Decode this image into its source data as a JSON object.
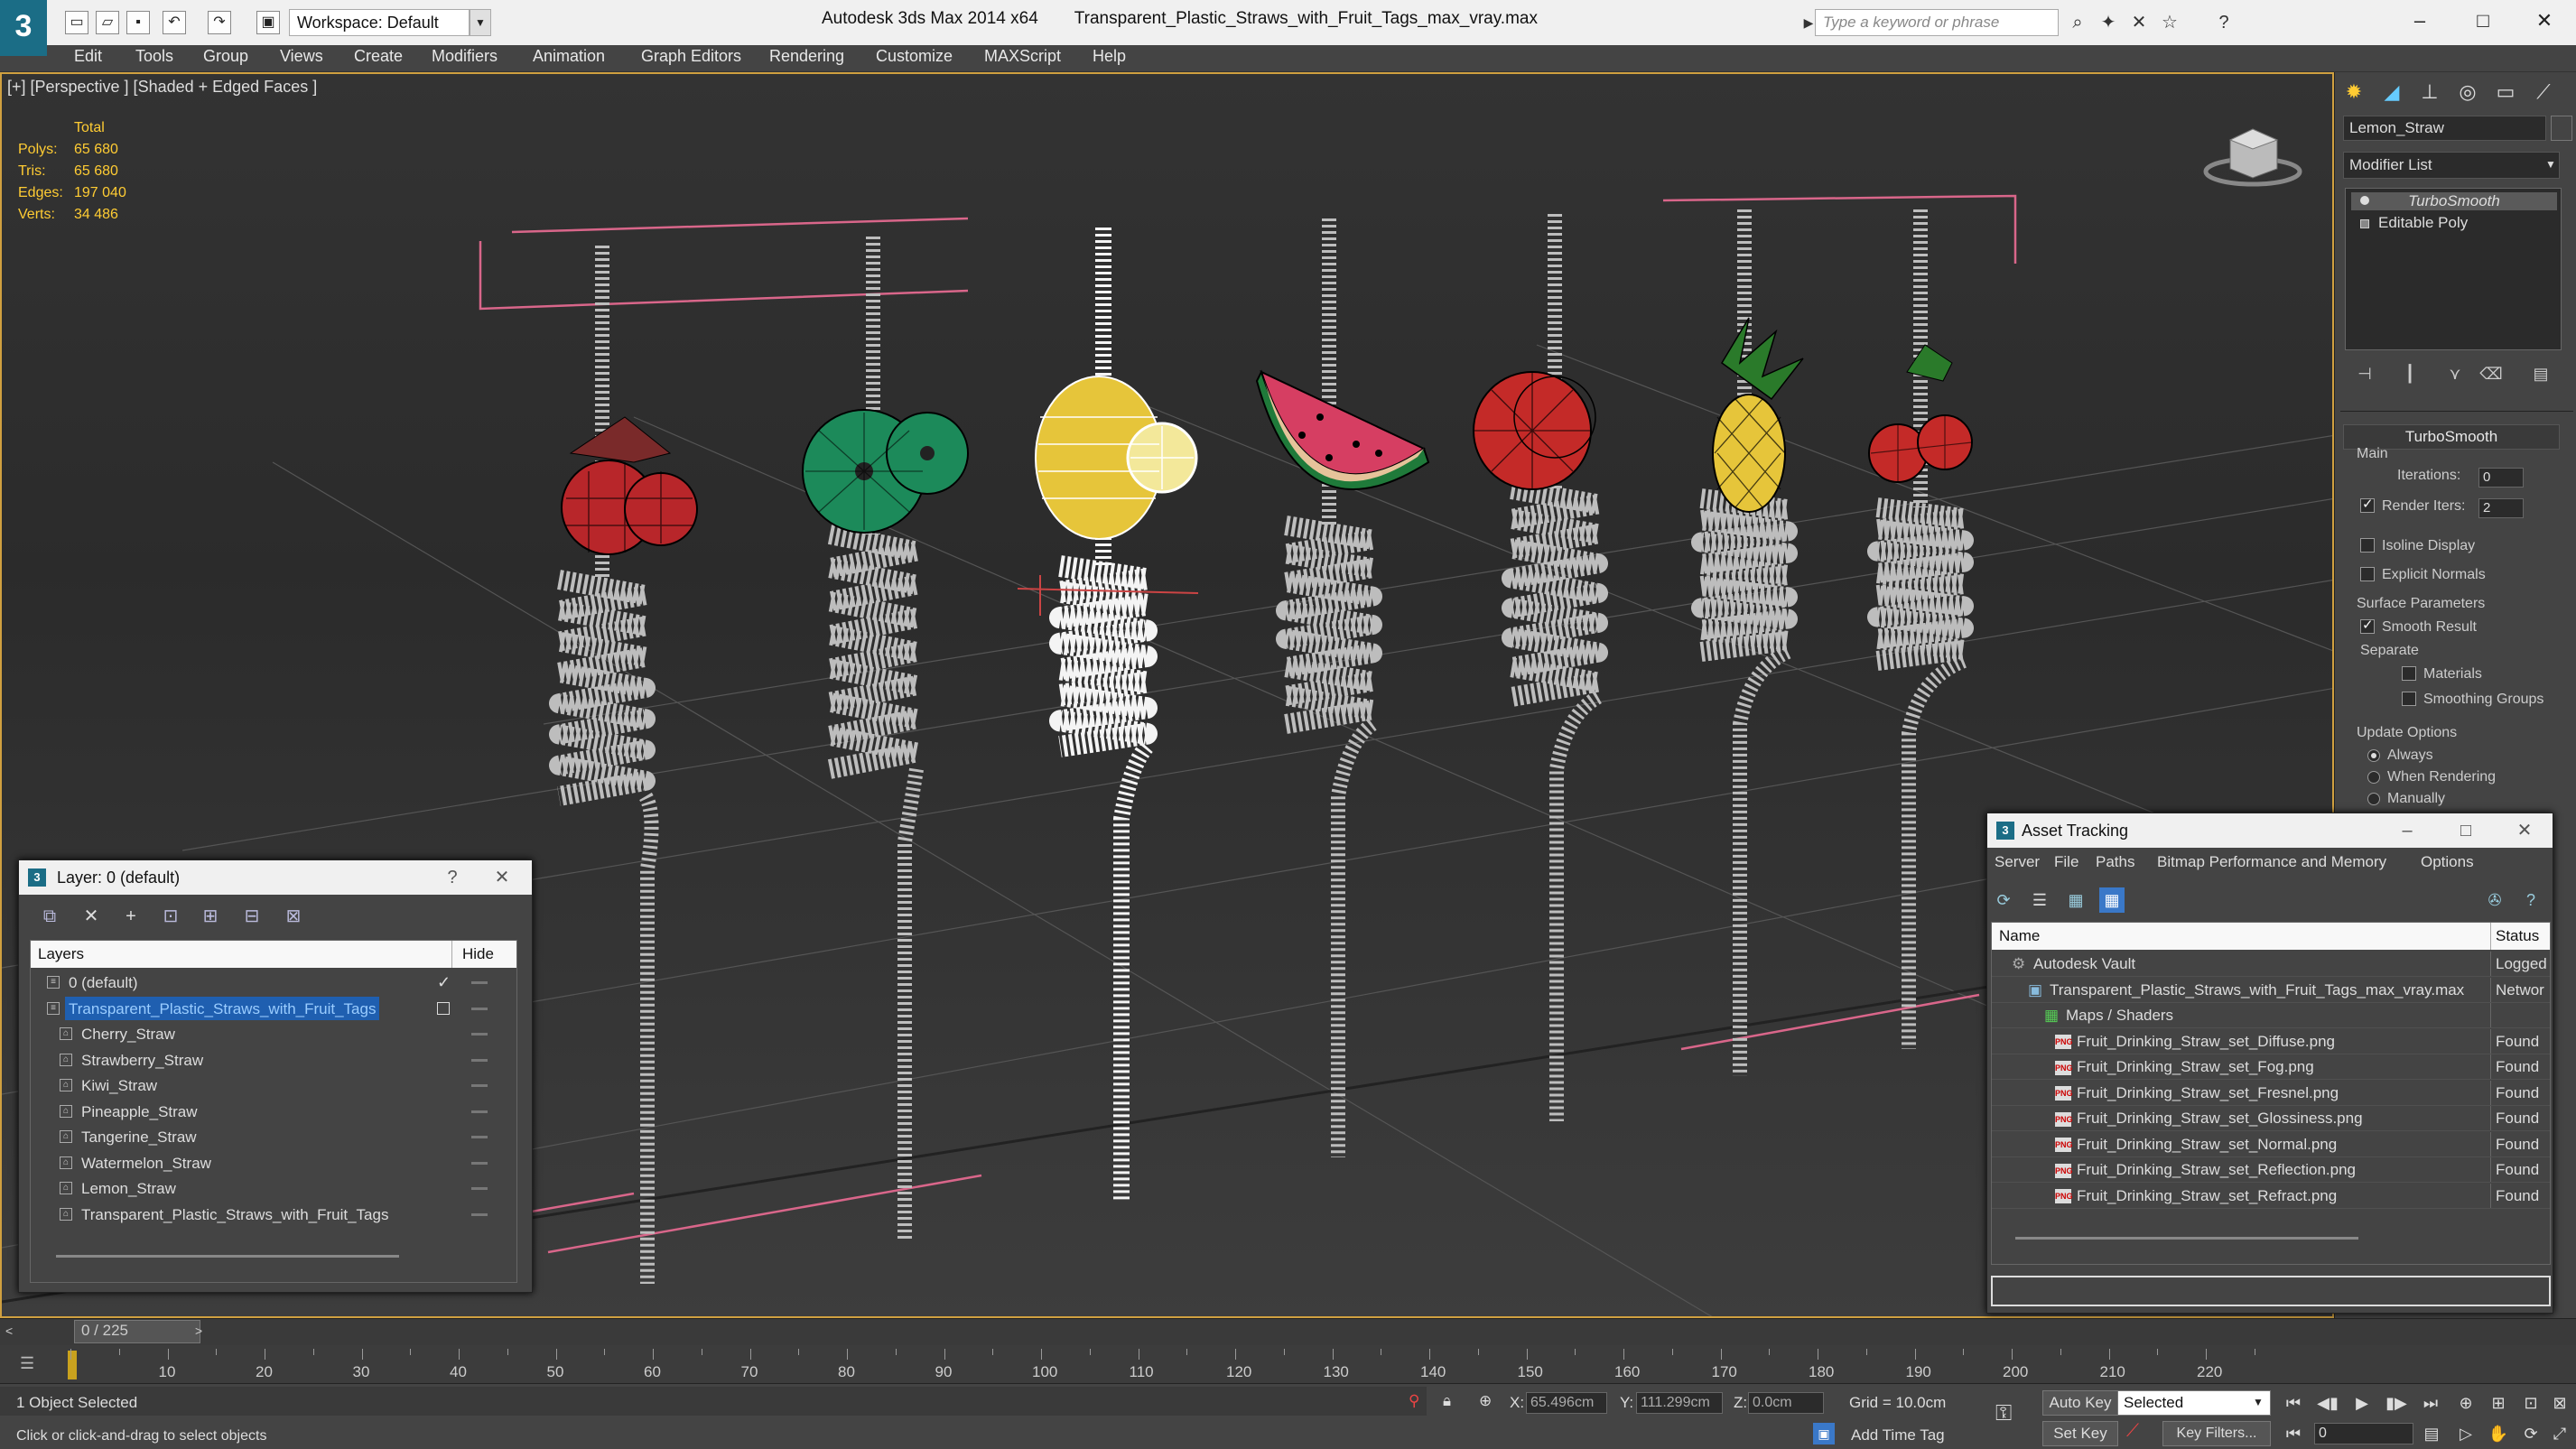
{
  "titlebar": {
    "app_name": "Autodesk 3ds Max  2014 x64",
    "file_name": "Transparent_Plastic_Straws_with_Fruit_Tags_max_vray.max",
    "workspace": "Workspace: Default",
    "search_placeholder": "Type a keyword or phrase"
  },
  "menu": [
    "Edit",
    "Tools",
    "Group",
    "Views",
    "Create",
    "Modifiers",
    "Animation",
    "Graph Editors",
    "Rendering",
    "Customize",
    "MAXScript",
    "Help"
  ],
  "viewport": {
    "label": "[+] [Perspective ] [Shaded + Edged Faces ]",
    "stats": {
      "header": "Total",
      "polys_label": "Polys:",
      "polys": "65 680",
      "tris_label": "Tris:",
      "tris": "65 680",
      "edges_label": "Edges:",
      "edges": "197 040",
      "verts_label": "Verts:",
      "verts": "34 486"
    }
  },
  "command_panel": {
    "object_name": "Lemon_Straw",
    "modifier_list": "Modifier List",
    "stack": [
      "TurboSmooth",
      "Editable Poly"
    ],
    "rollout_title": "TurboSmooth",
    "main_group": "Main",
    "iterations_label": "Iterations:",
    "iterations": "0",
    "render_iters_label": "Render Iters:",
    "render_iters": "2",
    "isoline": "Isoline Display",
    "explicit_normals": "Explicit Normals",
    "surface_group": "Surface Parameters",
    "smooth_result": "Smooth Result",
    "separate": "Separate",
    "materials": "Materials",
    "smoothing_groups": "Smoothing Groups",
    "update_group": "Update Options",
    "always": "Always",
    "when_rendering": "When Rendering",
    "manually": "Manually"
  },
  "layer_dialog": {
    "title": "Layer: 0 (default)",
    "help": "?",
    "col_layers": "Layers",
    "col_hide": "Hide",
    "rows": [
      {
        "name": "0 (default)",
        "level": 1
      },
      {
        "name": "Transparent_Plastic_Straws_with_Fruit_Tags",
        "level": 1
      },
      {
        "name": "Cherry_Straw",
        "level": 2
      },
      {
        "name": "Strawberry_Straw",
        "level": 2
      },
      {
        "name": "Kiwi_Straw",
        "level": 2
      },
      {
        "name": "Pineapple_Straw",
        "level": 2
      },
      {
        "name": "Tangerine_Straw",
        "level": 2
      },
      {
        "name": "Watermelon_Straw",
        "level": 2
      },
      {
        "name": "Lemon_Straw",
        "level": 2
      },
      {
        "name": "Transparent_Plastic_Straws_with_Fruit_Tags",
        "level": 2
      }
    ]
  },
  "asset_dialog": {
    "title": "Asset Tracking",
    "menu": [
      "Server",
      "File",
      "Paths",
      "Bitmap Performance and Memory",
      "Options"
    ],
    "col_name": "Name",
    "col_status": "Status",
    "rows": [
      {
        "name": "Autodesk Vault",
        "status": "Logged",
        "level": 1
      },
      {
        "name": "Transparent_Plastic_Straws_with_Fruit_Tags_max_vray.max",
        "status": "Networ",
        "level": 2
      },
      {
        "name": "Maps / Shaders",
        "status": "",
        "level": 3
      },
      {
        "name": "Fruit_Drinking_Straw_set_Diffuse.png",
        "status": "Found",
        "level": 4
      },
      {
        "name": "Fruit_Drinking_Straw_set_Fog.png",
        "status": "Found",
        "level": 4
      },
      {
        "name": "Fruit_Drinking_Straw_set_Fresnel.png",
        "status": "Found",
        "level": 4
      },
      {
        "name": "Fruit_Drinking_Straw_set_Glossiness.png",
        "status": "Found",
        "level": 4
      },
      {
        "name": "Fruit_Drinking_Straw_set_Normal.png",
        "status": "Found",
        "level": 4
      },
      {
        "name": "Fruit_Drinking_Straw_set_Reflection.png",
        "status": "Found",
        "level": 4
      },
      {
        "name": "Fruit_Drinking_Straw_set_Refract.png",
        "status": "Found",
        "level": 4
      }
    ]
  },
  "timeline": {
    "frame": "0 / 225",
    "ticks": [
      "10",
      "20",
      "30",
      "40",
      "50",
      "60",
      "70",
      "80",
      "90",
      "100",
      "110",
      "120",
      "130",
      "140",
      "150",
      "160",
      "170",
      "180",
      "190",
      "200",
      "210",
      "220"
    ]
  },
  "status": {
    "selection": "1 Object Selected",
    "prompt": "Click or click-and-drag to select objects",
    "x_label": "X:",
    "x": "65.496cm",
    "y_label": "Y:",
    "y": "111.299cm",
    "z_label": "Z:",
    "z": "0.0cm",
    "grid": "Grid = 10.0cm",
    "add_time_tag": "Add Time Tag",
    "auto_key": "Auto Key",
    "set_key": "Set Key",
    "selected": "Selected",
    "key_filters": "Key Filters...",
    "current_frame": "0"
  }
}
